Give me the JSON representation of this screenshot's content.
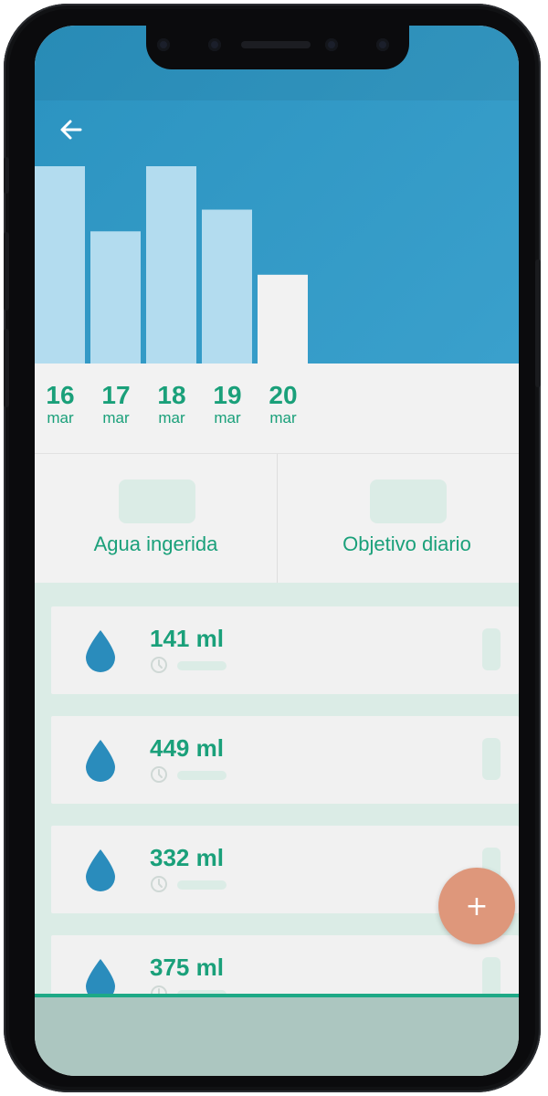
{
  "app": {
    "back_icon": "arrow-left-icon"
  },
  "chart_data": {
    "type": "bar",
    "categories": [
      "16 mar",
      "17 mar",
      "18 mar",
      "19 mar",
      "20 mar"
    ],
    "values": [
      100,
      67,
      100,
      78,
      45
    ],
    "ylim": [
      0,
      100
    ],
    "bar_colors": [
      "#b3dcef",
      "#b3dcef",
      "#b3dcef",
      "#b3dcef",
      "#f2f2f2"
    ],
    "xlabel": "",
    "ylabel": "",
    "grid": false
  },
  "dates": [
    {
      "day": "16",
      "month": "mar"
    },
    {
      "day": "17",
      "month": "mar"
    },
    {
      "day": "18",
      "month": "mar"
    },
    {
      "day": "19",
      "month": "mar"
    },
    {
      "day": "20",
      "month": "mar"
    }
  ],
  "summary": {
    "left_label": "Agua ingerida",
    "right_label": "Objetivo diario"
  },
  "entries": [
    {
      "amount": "141 ml",
      "icon": "water-drop-icon"
    },
    {
      "amount": "449 ml",
      "icon": "water-drop-icon"
    },
    {
      "amount": "332 ml",
      "icon": "water-drop-icon"
    },
    {
      "amount": "375 ml",
      "icon": "water-drop-icon"
    }
  ],
  "fab": {
    "label": "+",
    "icon": "plus-icon"
  },
  "colors": {
    "header": "#2f98c4",
    "bar": "#b3dcef",
    "accent": "#1aa07a",
    "fab": "#de977b",
    "drop": "#2a8cbc"
  }
}
